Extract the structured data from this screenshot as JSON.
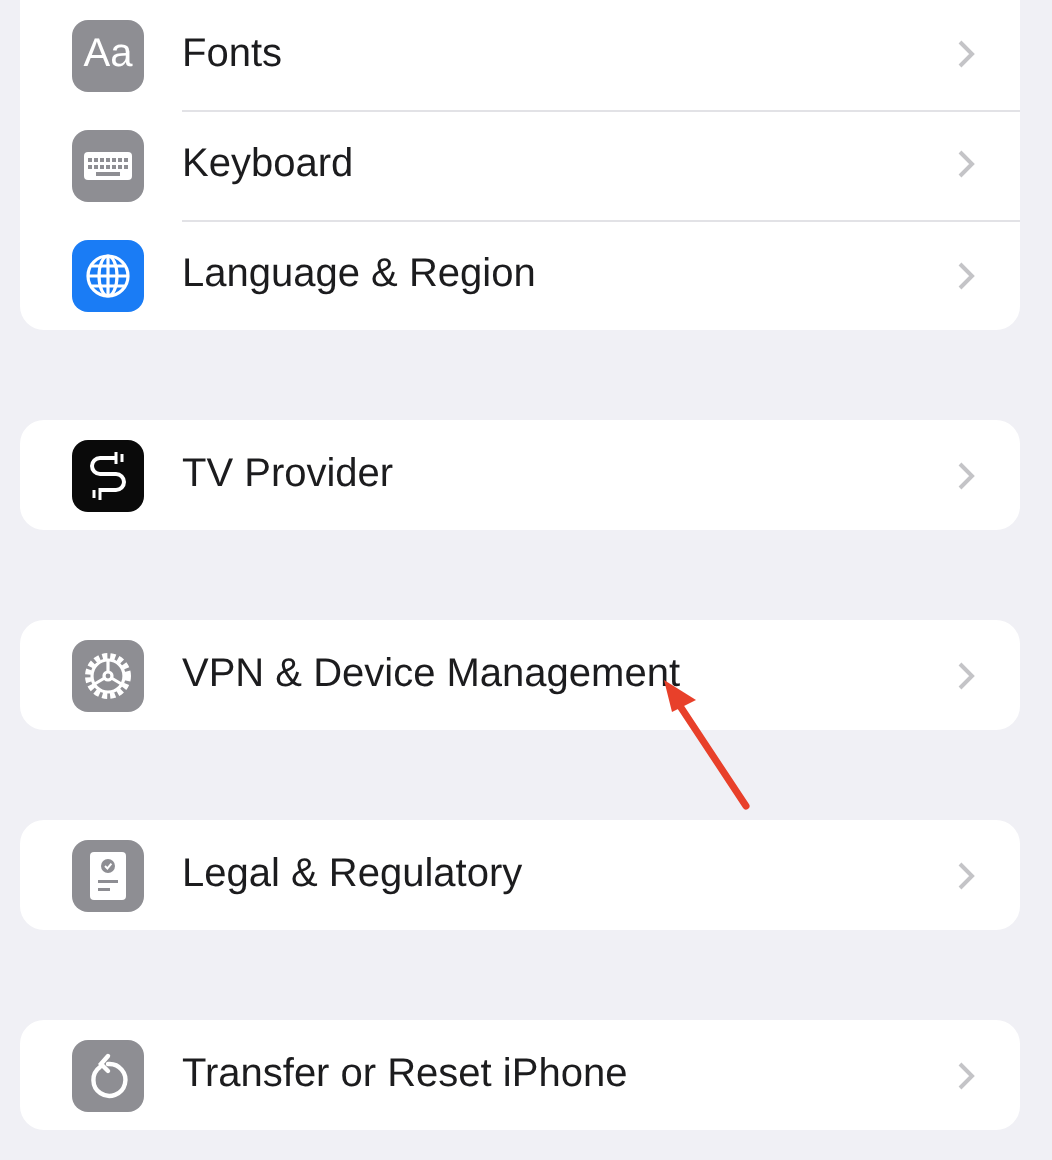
{
  "groups": [
    {
      "rows": [
        {
          "label": "Fonts",
          "kind": "text",
          "icon_text": "Aa"
        },
        {
          "label": "Keyboard",
          "kind": "keyboard"
        },
        {
          "label": "Language & Region",
          "kind": "globe"
        }
      ]
    },
    {
      "rows": [
        {
          "label": "TV Provider",
          "kind": "cable"
        }
      ]
    },
    {
      "rows": [
        {
          "label": "VPN & Device Management",
          "kind": "gear"
        }
      ]
    },
    {
      "rows": [
        {
          "label": "Legal & Regulatory",
          "kind": "document"
        }
      ]
    },
    {
      "rows": [
        {
          "label": "Transfer or Reset iPhone",
          "kind": "reset"
        }
      ]
    }
  ]
}
